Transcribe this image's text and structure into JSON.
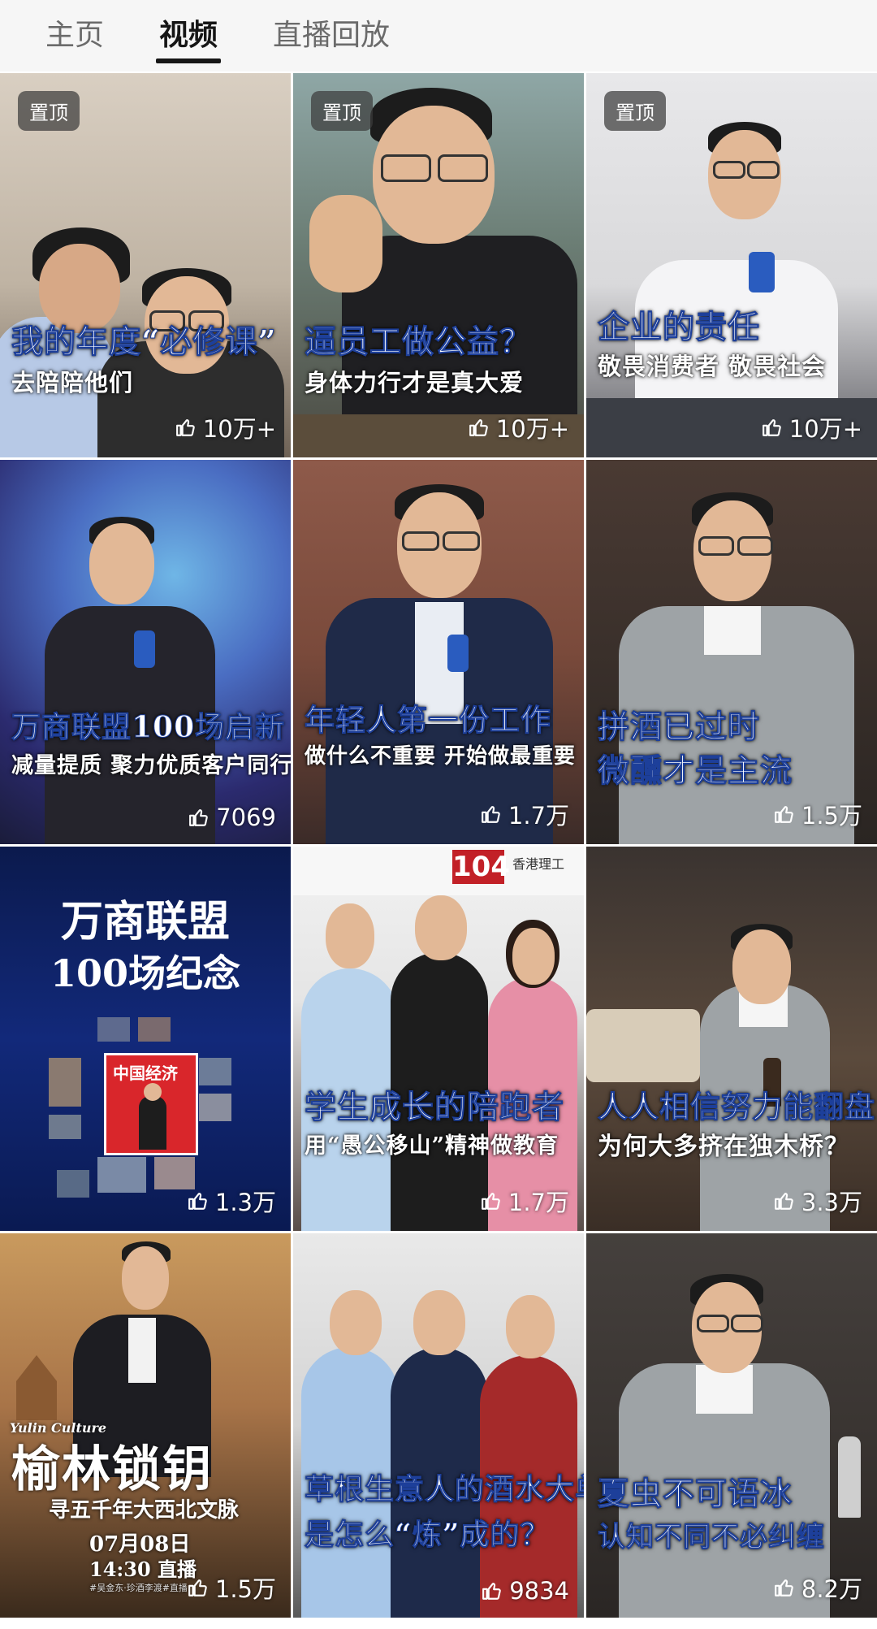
{
  "tabs": [
    {
      "label": "主页",
      "active": false
    },
    {
      "label": "视频",
      "active": true
    },
    {
      "label": "直播回放",
      "active": false
    }
  ],
  "icons": {
    "like": "thumbs-up-icon"
  },
  "videos": [
    {
      "pinned": "置顶",
      "title": "我的年度“必修课”",
      "subtitle": "去陪陪他们",
      "likes": "10万+"
    },
    {
      "pinned": "置顶",
      "title": "逼员工做公益？",
      "subtitle": "身体力行才是真大爱",
      "likes": "10万+"
    },
    {
      "pinned": "置顶",
      "title": "企业的责任",
      "subtitle": "敬畏消费者 敬畏社会",
      "likes": "10万+"
    },
    {
      "title": "万商联盟100场启新",
      "subtitle": "减量提质 聚力优质客户同行",
      "likes": "7069"
    },
    {
      "title": "年轻人第一份工作",
      "subtitle": "做什么不重要 开始做最重要",
      "likes": "1.7万"
    },
    {
      "title": "拼酒已过时",
      "subtitle": "微醺才是主流",
      "likes": "1.5万"
    },
    {
      "title": "万商联盟",
      "subtitle": "100场纪念",
      "likes": "1.3万",
      "badge": "中国经济"
    },
    {
      "title": "学生成长的陪跑者",
      "subtitle": "用“愚公移山”精神做教育",
      "likes": "1.7万",
      "banner_number": "104",
      "banner_text": "香港理工"
    },
    {
      "title": "人人相信努力能翻盘",
      "subtitle": "为何大多挤在独木桥？",
      "likes": "3.3万"
    },
    {
      "title": "榆林锁钥",
      "subtitle": "寻五千年大西北文脉",
      "likes": "1.5万",
      "brand": "Yulin Culture",
      "date": "07月08日",
      "time": "14:30 直播",
      "tags": "#吴金东·珍酒李渡#直播"
    },
    {
      "title": "草根生意人的酒水大单",
      "subtitle": "是怎么“炼”成的？",
      "likes": "9834"
    },
    {
      "title": "夏虫不可语冰",
      "subtitle": "认知不同不必纠缠",
      "likes": "8.2万"
    }
  ],
  "colors": {
    "accent_text": "#ffffff",
    "caption_stroke": "#1d3f9a",
    "tab_active": "#161616",
    "tab_inactive": "#6b6b6b"
  }
}
